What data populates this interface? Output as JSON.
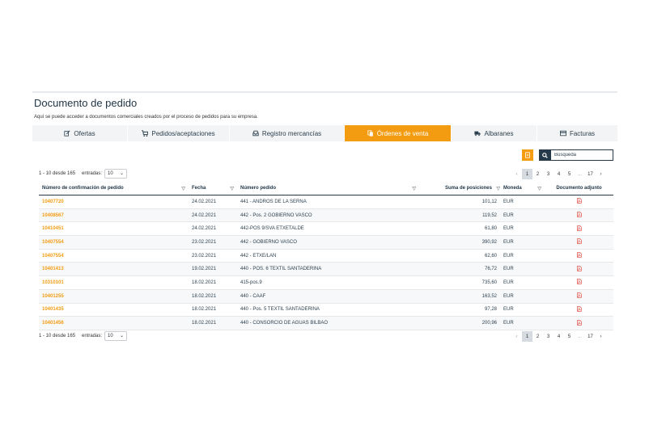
{
  "page": {
    "title": "Documento de pedido",
    "subtitle": "Aquí se puede acceder a documentos comerciales creados por el proceso de pedidos para su empresa."
  },
  "tabs": [
    {
      "label": "Ofertas",
      "icon": "edit-icon"
    },
    {
      "label": "Pedidos/aceptaciones",
      "icon": "cart-icon"
    },
    {
      "label": "Registro mercancías",
      "icon": "inbox-icon"
    },
    {
      "label": "Órdenes de venta",
      "icon": "copy-icon",
      "active": true
    },
    {
      "label": "Albaranes",
      "icon": "truck-icon"
    },
    {
      "label": "Facturas",
      "icon": "credit-card-icon"
    }
  ],
  "search": {
    "placeholder": "Búsqueda"
  },
  "pagination": {
    "info": "1 - 10 desde 165",
    "entries_label": "entradas:",
    "entries_value": "10",
    "prev": "‹",
    "pages": [
      "1",
      "2",
      "3",
      "4",
      "5"
    ],
    "ellipsis": "...",
    "last": "17",
    "next": "›"
  },
  "table": {
    "headers": {
      "number": "Número de confirmación de pedido",
      "date": "Fecha",
      "order": "Número pedido",
      "sum": "Suma de posiciones",
      "currency": "Moneda",
      "doc": "Documento adjunto"
    },
    "rows": [
      {
        "number": "10407720",
        "date": "24.02.2021",
        "order": "441 - ANDROS DE LA SERNA",
        "sum": "101,12",
        "currency": "EUR"
      },
      {
        "number": "10408567",
        "date": "24.02.2021",
        "order": "442 - Pos. 2 GOBIERNO VASCO",
        "sum": "119,52",
        "currency": "EUR"
      },
      {
        "number": "10410451",
        "date": "24.02.2021",
        "order": "442-POS 9/SVA ETXETALDE",
        "sum": "61,80",
        "currency": "EUR"
      },
      {
        "number": "10407554",
        "date": "23.02.2021",
        "order": "442 - GOBIERNO VASCO",
        "sum": "390,92",
        "currency": "EUR"
      },
      {
        "number": "10407554",
        "date": "23.02.2021",
        "order": "442 - ETXE/LAN",
        "sum": "62,60",
        "currency": "EUR"
      },
      {
        "number": "10401413",
        "date": "19.02.2021",
        "order": "440 - POS. 6 TEXTIL SANTADERINA",
        "sum": "76,72",
        "currency": "EUR"
      },
      {
        "number": "10310101",
        "date": "18.02.2021",
        "order": "415-pos.9",
        "sum": "735,60",
        "currency": "EUR"
      },
      {
        "number": "10401255",
        "date": "18.02.2021",
        "order": "440 - CAAF",
        "sum": "163,52",
        "currency": "EUR"
      },
      {
        "number": "10401435",
        "date": "18.02.2021",
        "order": "440 - Pos. 5 TEXTIL SANTADERINA",
        "sum": "97,28",
        "currency": "EUR"
      },
      {
        "number": "10401456",
        "date": "18.02.2021",
        "order": "440 - CONSORCIO DE AGUAS BILBAO",
        "sum": "200,96",
        "currency": "EUR"
      }
    ]
  },
  "colors": {
    "accent": "#f39c12",
    "dark": "#26394a"
  }
}
